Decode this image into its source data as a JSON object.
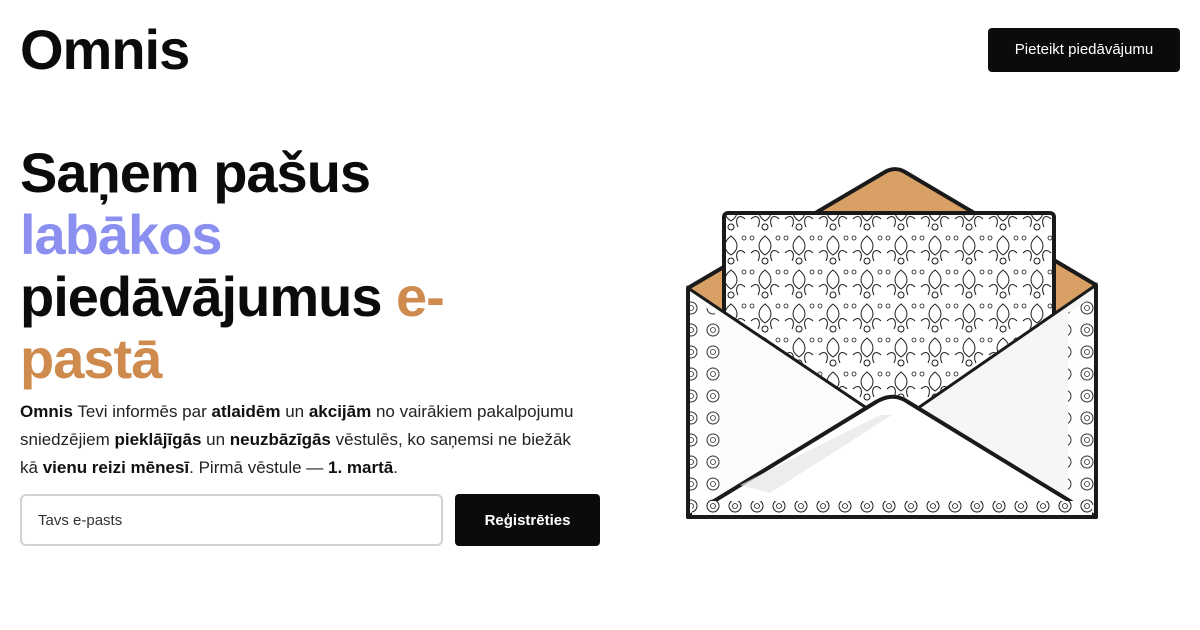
{
  "header": {
    "logo": "Omnis",
    "cta_label": "Pieteikt piedāvājumu"
  },
  "hero": {
    "headline": {
      "line1": "Saņem pašus",
      "accent1": "labākos",
      "part3": "piedāvājumus",
      "accent2_a": "e-",
      "accent2_b": "pastā"
    },
    "description": {
      "b1": "Omnis",
      "t1": " Tevi informēs par ",
      "b2": "atlaidēm",
      "t2": " un ",
      "b3": "akcijām",
      "t3": " no vairākiem pakalpojumu sniedzējiem ",
      "b4": "pieklājīgās",
      "t4": " un ",
      "b5": "neuzbāzīgās",
      "t5": " vēstulēs, ko saņemsi ne biežāk kā ",
      "b6": "vienu reizi mēnesī",
      "t6": ". Pirmā vēstule — ",
      "b7": "1. martā",
      "t7": "."
    },
    "form": {
      "email_placeholder": "Tavs e-pasts",
      "submit_label": "Reģistrēties"
    }
  },
  "illustration": {
    "icon": "envelope-illustration",
    "colors": {
      "flap": "#d9a066",
      "paper": "#ffffff",
      "outline": "#1a1a1a",
      "shadow": "#e6e6e6"
    }
  },
  "colors": {
    "accent_purple": "#8b90f0",
    "accent_orange": "#cf8a4d",
    "button_bg": "#0b0b0b"
  }
}
